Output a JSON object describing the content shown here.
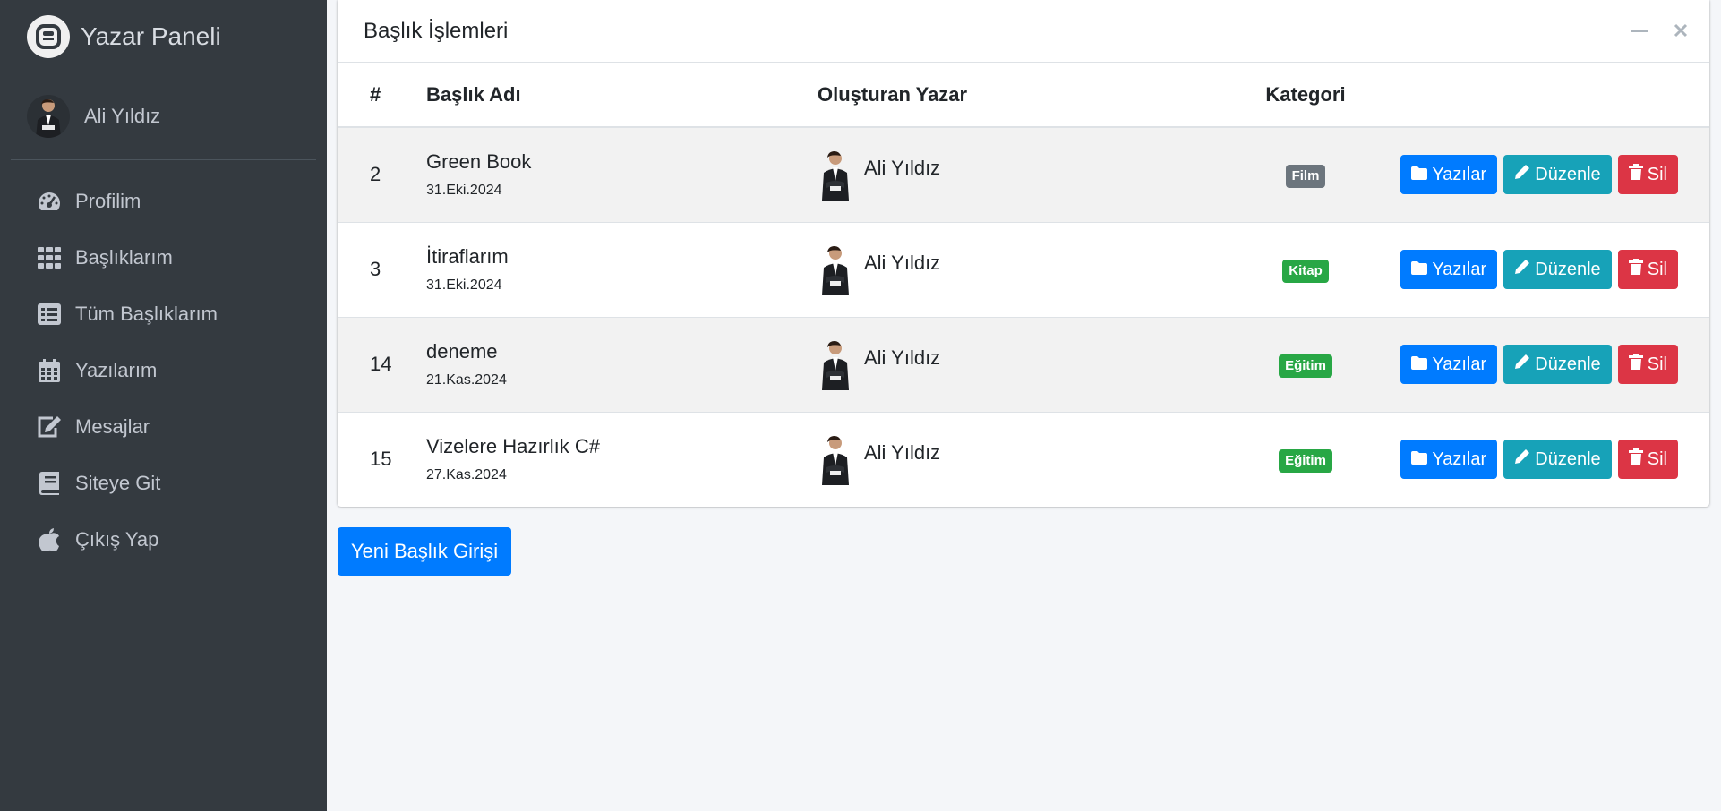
{
  "brand": {
    "title": "Yazar Paneli",
    "logo_icon": "brand-logo-icon"
  },
  "user": {
    "name": "Ali Yıldız"
  },
  "nav": [
    {
      "label": "Profilim",
      "icon": "tachometer-icon"
    },
    {
      "label": "Başlıklarım",
      "icon": "grid-icon"
    },
    {
      "label": "Tüm Başlıklarım",
      "icon": "list-icon"
    },
    {
      "label": "Yazılarım",
      "icon": "calendar-icon"
    },
    {
      "label": "Mesajlar",
      "icon": "edit-icon"
    },
    {
      "label": "Siteye Git",
      "icon": "book-icon"
    },
    {
      "label": "Çıkış Yap",
      "icon": "apple-icon"
    }
  ],
  "card": {
    "title": "Başlık İşlemleri",
    "columns": {
      "num": "#",
      "title": "Başlık Adı",
      "author": "Oluşturan Yazar",
      "category": "Kategori"
    },
    "rows": [
      {
        "id": "2",
        "title": "Green Book",
        "date": "31.Eki.2024",
        "author": "Ali Yıldız",
        "category": "Film",
        "category_color": "#6c757d"
      },
      {
        "id": "3",
        "title": "İtiraflarım",
        "date": "31.Eki.2024",
        "author": "Ali Yıldız",
        "category": "Kitap",
        "category_color": "#28a745"
      },
      {
        "id": "14",
        "title": "deneme",
        "date": "21.Kas.2024",
        "author": "Ali Yıldız",
        "category": "Eğitim",
        "category_color": "#28a745"
      },
      {
        "id": "15",
        "title": "Vizelere Hazırlık C#",
        "date": "27.Kas.2024",
        "author": "Ali Yıldız",
        "category": "Eğitim",
        "category_color": "#28a745"
      }
    ],
    "actions": {
      "posts": "Yazılar",
      "edit": "Düzenle",
      "delete": "Sil"
    }
  },
  "new_button": "Yeni Başlık Girişi",
  "colors": {
    "sidebar": "#343a40",
    "primary": "#007bff",
    "info": "#17a2b8",
    "danger": "#dc3545",
    "success": "#28a745",
    "secondary": "#6c757d"
  }
}
